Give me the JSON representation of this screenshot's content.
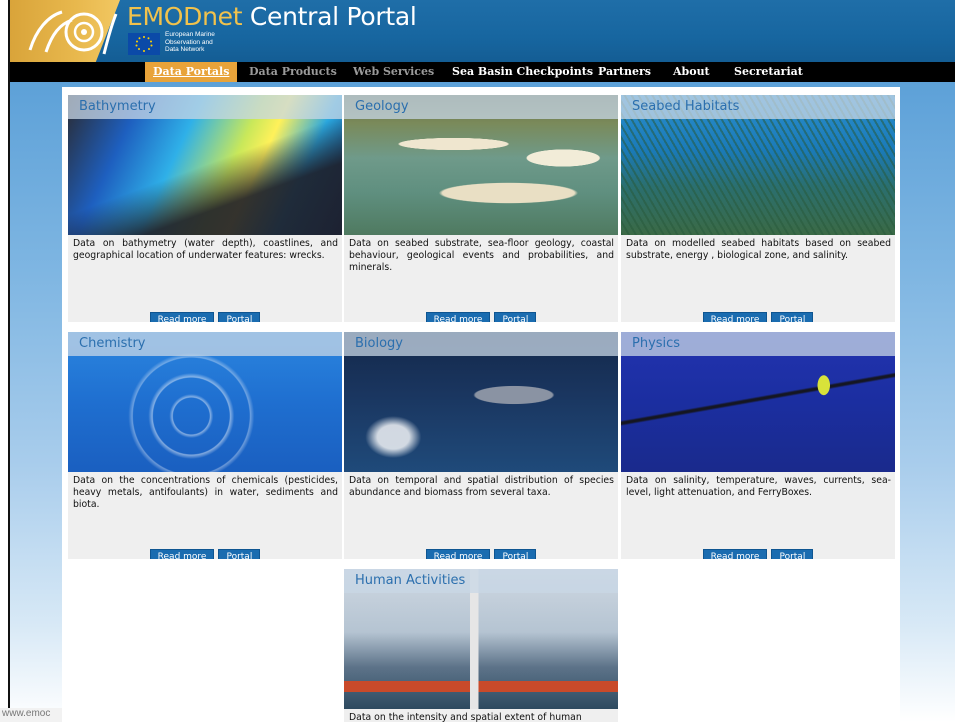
{
  "header": {
    "title_part1": "EMODnet",
    "title_part2": " Central Portal",
    "eu_text": "European Marine\nObservation and\nData Network"
  },
  "nav": [
    {
      "label": "Data Portals",
      "active": true
    },
    {
      "label": "Data Products"
    },
    {
      "label": "Web Services"
    },
    {
      "label": "Sea Basin Checkpoints"
    },
    {
      "label": "Partners"
    },
    {
      "label": "About"
    },
    {
      "label": "Secretariat"
    }
  ],
  "buttons": {
    "read_more": "Read more",
    "portal": "Portal"
  },
  "cards": [
    {
      "title": "Bathymetry",
      "desc": "Data on bathymetry (water depth), coastlines, and geographical location of underwater features: wrecks."
    },
    {
      "title": "Geology",
      "desc": "Data on seabed substrate, sea-floor geology, coastal behaviour, geological events and probabilities, and minerals."
    },
    {
      "title": "Seabed Habitats",
      "desc": "Data on modelled seabed habitats based on seabed substrate, energy , biological zone, and salinity."
    },
    {
      "title": "Chemistry",
      "desc": "Data on the concentrations of chemicals (pesticides, heavy metals, antifoulants) in water, sediments and biota."
    },
    {
      "title": "Biology",
      "desc": "Data on temporal and spatial distribution of species abundance and biomass from several taxa."
    },
    {
      "title": "Physics",
      "desc": "Data on salinity, temperature, waves, currents, sea-level, light attenuation, and FerryBoxes."
    },
    {
      "title": "Human Activities",
      "desc": "Data on the intensity and spatial extent of human"
    }
  ],
  "statusbar": "www.emoc",
  "colors": {
    "accent": "#e8a33a",
    "header_blue": "#1766a0",
    "button_blue": "#1a6cb0",
    "title_blue": "#2b6fae"
  }
}
